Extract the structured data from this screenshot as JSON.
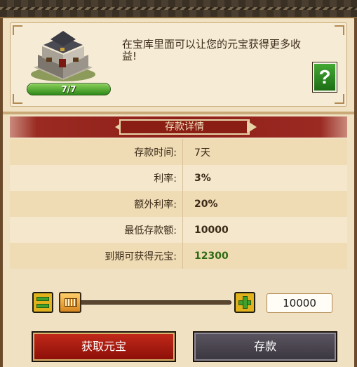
{
  "info": {
    "description": "在宝库里面可以让您的元宝获得更多收益!",
    "level": "7/7",
    "help_label": "?"
  },
  "details": {
    "header": "存款详情",
    "rows": [
      {
        "label": "存款时间:",
        "value": "7天"
      },
      {
        "label": "利率:",
        "value": "3%"
      },
      {
        "label": "额外利率:",
        "value": "20%"
      },
      {
        "label": "最低存款额:",
        "value": "10000"
      },
      {
        "label": "到期可获得元宝:",
        "value": "12300"
      }
    ]
  },
  "amount": {
    "value": "10000",
    "slider_fraction": 0
  },
  "buttons": {
    "get_ingots": "获取元宝",
    "deposit": "存款"
  },
  "colors": {
    "accent_green": "#2f6a14",
    "header_red": "#8e1f18",
    "get_button_red": "#c42a1a",
    "deposit_button_gray": "#4a4650"
  }
}
